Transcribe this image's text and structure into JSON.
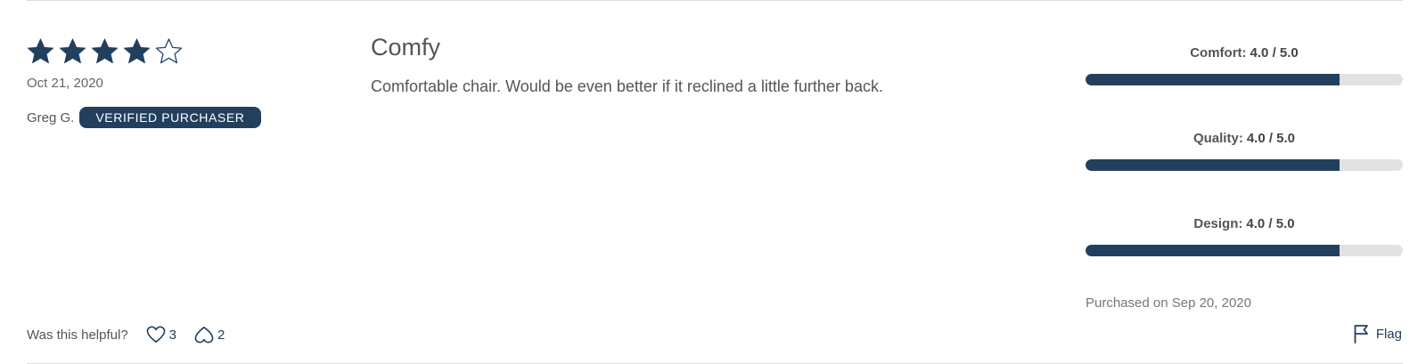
{
  "review": {
    "rating": 4,
    "rating_max": 5,
    "date": "Oct 21, 2020",
    "author": "Greg G.",
    "badge": "VERIFIED PURCHASER",
    "title": "Comfy",
    "body": "Comfortable chair. Would be even better if it reclined a little further back.",
    "purchased": "Purchased on Sep 20, 2020"
  },
  "attributes": [
    {
      "label": "Comfort:",
      "value_text": "4.0 / 5.0",
      "value": 4.0,
      "max": 5.0
    },
    {
      "label": "Quality:",
      "value_text": "4.0 / 5.0",
      "value": 4.0,
      "max": 5.0
    },
    {
      "label": "Design:",
      "value_text": "4.0 / 5.0",
      "value": 4.0,
      "max": 5.0
    }
  ],
  "footer": {
    "helpful_label": "Was this helpful?",
    "helpful_count": "3",
    "unhelpful_count": "2",
    "flag_label": "Flag"
  },
  "colors": {
    "accent": "#22405e",
    "bar_track": "#e2e2e2",
    "divider": "#dcdcdc"
  },
  "icons": [
    "star-filled-icon",
    "star-outline-icon",
    "heart-icon",
    "heart-down-icon",
    "flag-icon"
  ]
}
